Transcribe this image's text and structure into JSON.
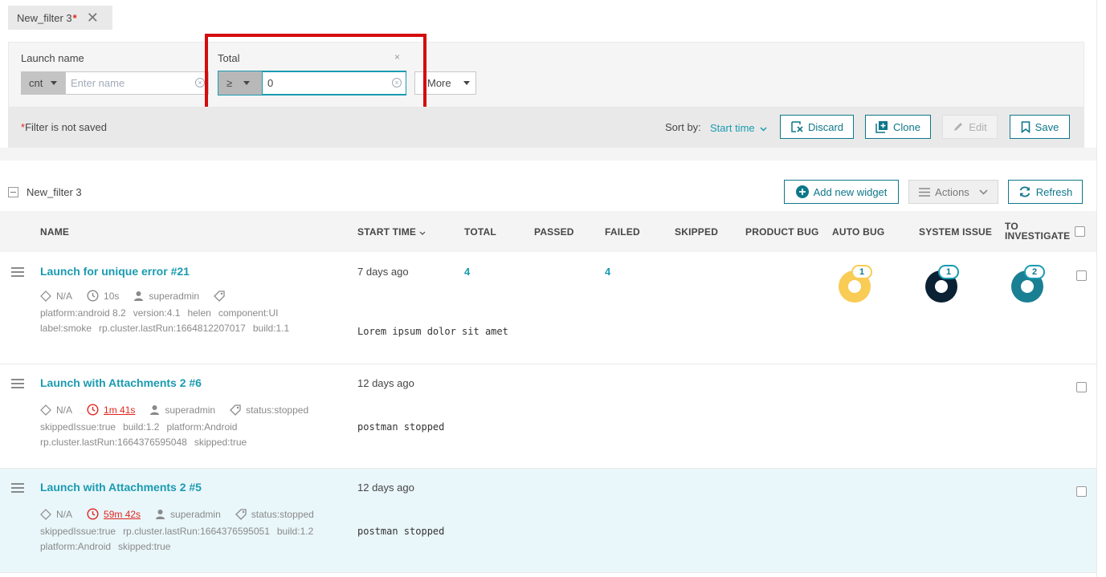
{
  "tab": {
    "name": "New_filter 3",
    "unsaved_mark": "*"
  },
  "filter": {
    "launch_name": {
      "label": "Launch name",
      "condition": "cnt",
      "placeholder": "Enter name"
    },
    "total": {
      "label": "Total",
      "condition": "≥",
      "value": "0",
      "remove": "×"
    },
    "more_label": "More",
    "status_mark": "*",
    "status_text": "Filter is not saved",
    "sort_label": "Sort by:",
    "sort_value": "Start time",
    "buttons": {
      "discard": "Discard",
      "clone": "Clone",
      "edit": "Edit",
      "save": "Save"
    }
  },
  "list": {
    "filter_name": "New_filter 3",
    "add_widget": "Add new widget",
    "actions": "Actions",
    "refresh": "Refresh",
    "columns": [
      "NAME",
      "START TIME",
      "TOTAL",
      "PASSED",
      "FAILED",
      "SKIPPED",
      "PRODUCT BUG",
      "AUTO BUG",
      "SYSTEM ISSUE",
      "TO",
      "INVESTIGATE"
    ]
  },
  "colors": {
    "accent": "#1a9bb0",
    "auto_bug": "#f8cc55",
    "system_issue": "#0a2233",
    "to_investigate": "#1a7f92",
    "error": "#e3251f"
  },
  "launches": [
    {
      "name": "Launch for unique error #21",
      "na": "N/A",
      "duration": "10s",
      "owner": "superadmin",
      "attributes_line1": [
        "platform:android 8.2",
        "version:4.1",
        "helen",
        "component:UI"
      ],
      "attributes_line2": [
        "label:smoke",
        "rp.cluster.lastRun:1664812207017",
        "build:1.1"
      ],
      "start_time": "7 days ago",
      "description": "Lorem ipsum dolor sit amet",
      "total": "4",
      "failed": "4",
      "auto_bug": "1",
      "system_issue": "1",
      "to_investigate": "2"
    },
    {
      "name": "Launch with Attachments 2 #6",
      "na": "N/A",
      "duration": "1m 41s",
      "owner": "superadmin",
      "status": "status:stopped",
      "attributes_line1": [
        "skippedIssue:true",
        "build:1.2",
        "platform:Android"
      ],
      "attributes_line2": [
        "rp.cluster.lastRun:1664376595048",
        "skipped:true"
      ],
      "start_time": "12 days ago",
      "description": "postman stopped"
    },
    {
      "name": "Launch with Attachments 2 #5",
      "na": "N/A",
      "duration": "59m 42s",
      "owner": "superadmin",
      "status": "status:stopped",
      "attributes_line1": [
        "skippedIssue:true",
        "rp.cluster.lastRun:1664376595051",
        "build:1.2"
      ],
      "attributes_line2": [
        "platform:Android",
        "skipped:true"
      ],
      "start_time": "12 days ago",
      "description": "postman stopped"
    }
  ]
}
